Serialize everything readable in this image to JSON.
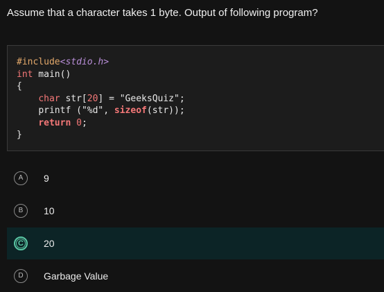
{
  "question": {
    "text": "Assume that a character takes 1 byte. Output of following program?"
  },
  "code": {
    "line1_directive": "#include",
    "line1_header": "<stdio.h>",
    "line2_type": "int",
    "line2_rest": " main()",
    "line3": "{",
    "line4_type": "char",
    "line4_a": " str[",
    "line4_num": "20",
    "line4_b": "] = ",
    "line4_str": "\"GeeksQuiz\"",
    "line4_c": ";",
    "line5_fn": "printf",
    "line5_a": " (",
    "line5_str": "\"%d\"",
    "line5_b": ", ",
    "line5_kw": "sizeof",
    "line5_c": "(str));",
    "line6_kw": "return",
    "line6_a": " ",
    "line6_num": "0",
    "line6_b": ";",
    "line7": "}"
  },
  "options": [
    {
      "letter": "A",
      "text": "9",
      "selected": false
    },
    {
      "letter": "B",
      "text": "10",
      "selected": false
    },
    {
      "letter": "C",
      "text": "20",
      "selected": true
    },
    {
      "letter": "D",
      "text": "Garbage Value",
      "selected": false
    }
  ],
  "colors": {
    "background": "#131313",
    "code_background": "#1c1c1c",
    "selected_background": "#0c2426",
    "accent": "#5ac7a4",
    "keyword": "#f57878",
    "header": "#b98ed8",
    "directive": "#e3a86a"
  }
}
